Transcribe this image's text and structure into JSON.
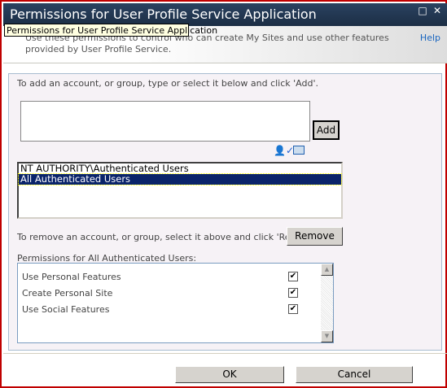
{
  "window": {
    "title": "Permissions for User Profile Service Application",
    "tooltip": "Permissions for User Profile Service Application"
  },
  "header": {
    "intro": "Use these permissions to control who can create My Sites and use other features provided by User Profile Service.",
    "help": "Help"
  },
  "add_section": {
    "instruction": "To add an account, or group, type or select it below and click 'Add'.",
    "input_value": "",
    "add_label": "Add",
    "icons": [
      "check-names-icon",
      "browse-address-book-icon"
    ]
  },
  "accounts": {
    "items": [
      {
        "label": "NT AUTHORITY\\Authenticated Users",
        "selected": false
      },
      {
        "label": "All Authenticated Users",
        "selected": true
      }
    ]
  },
  "remove_section": {
    "instruction": "To remove an account, or group, select it above and click 'Remove'.",
    "remove_label": "Remove"
  },
  "permissions": {
    "label": "Permissions for All Authenticated Users:",
    "items": [
      {
        "label": "Use Personal Features",
        "checked": true
      },
      {
        "label": "Create Personal Site",
        "checked": true
      },
      {
        "label": "Use Social Features",
        "checked": true
      }
    ]
  },
  "footer": {
    "ok": "OK",
    "cancel": "Cancel"
  },
  "colors": {
    "border": "#c00000",
    "titlebar": "#1f3550",
    "selection": "#0a246a",
    "link": "#1a66c0"
  }
}
